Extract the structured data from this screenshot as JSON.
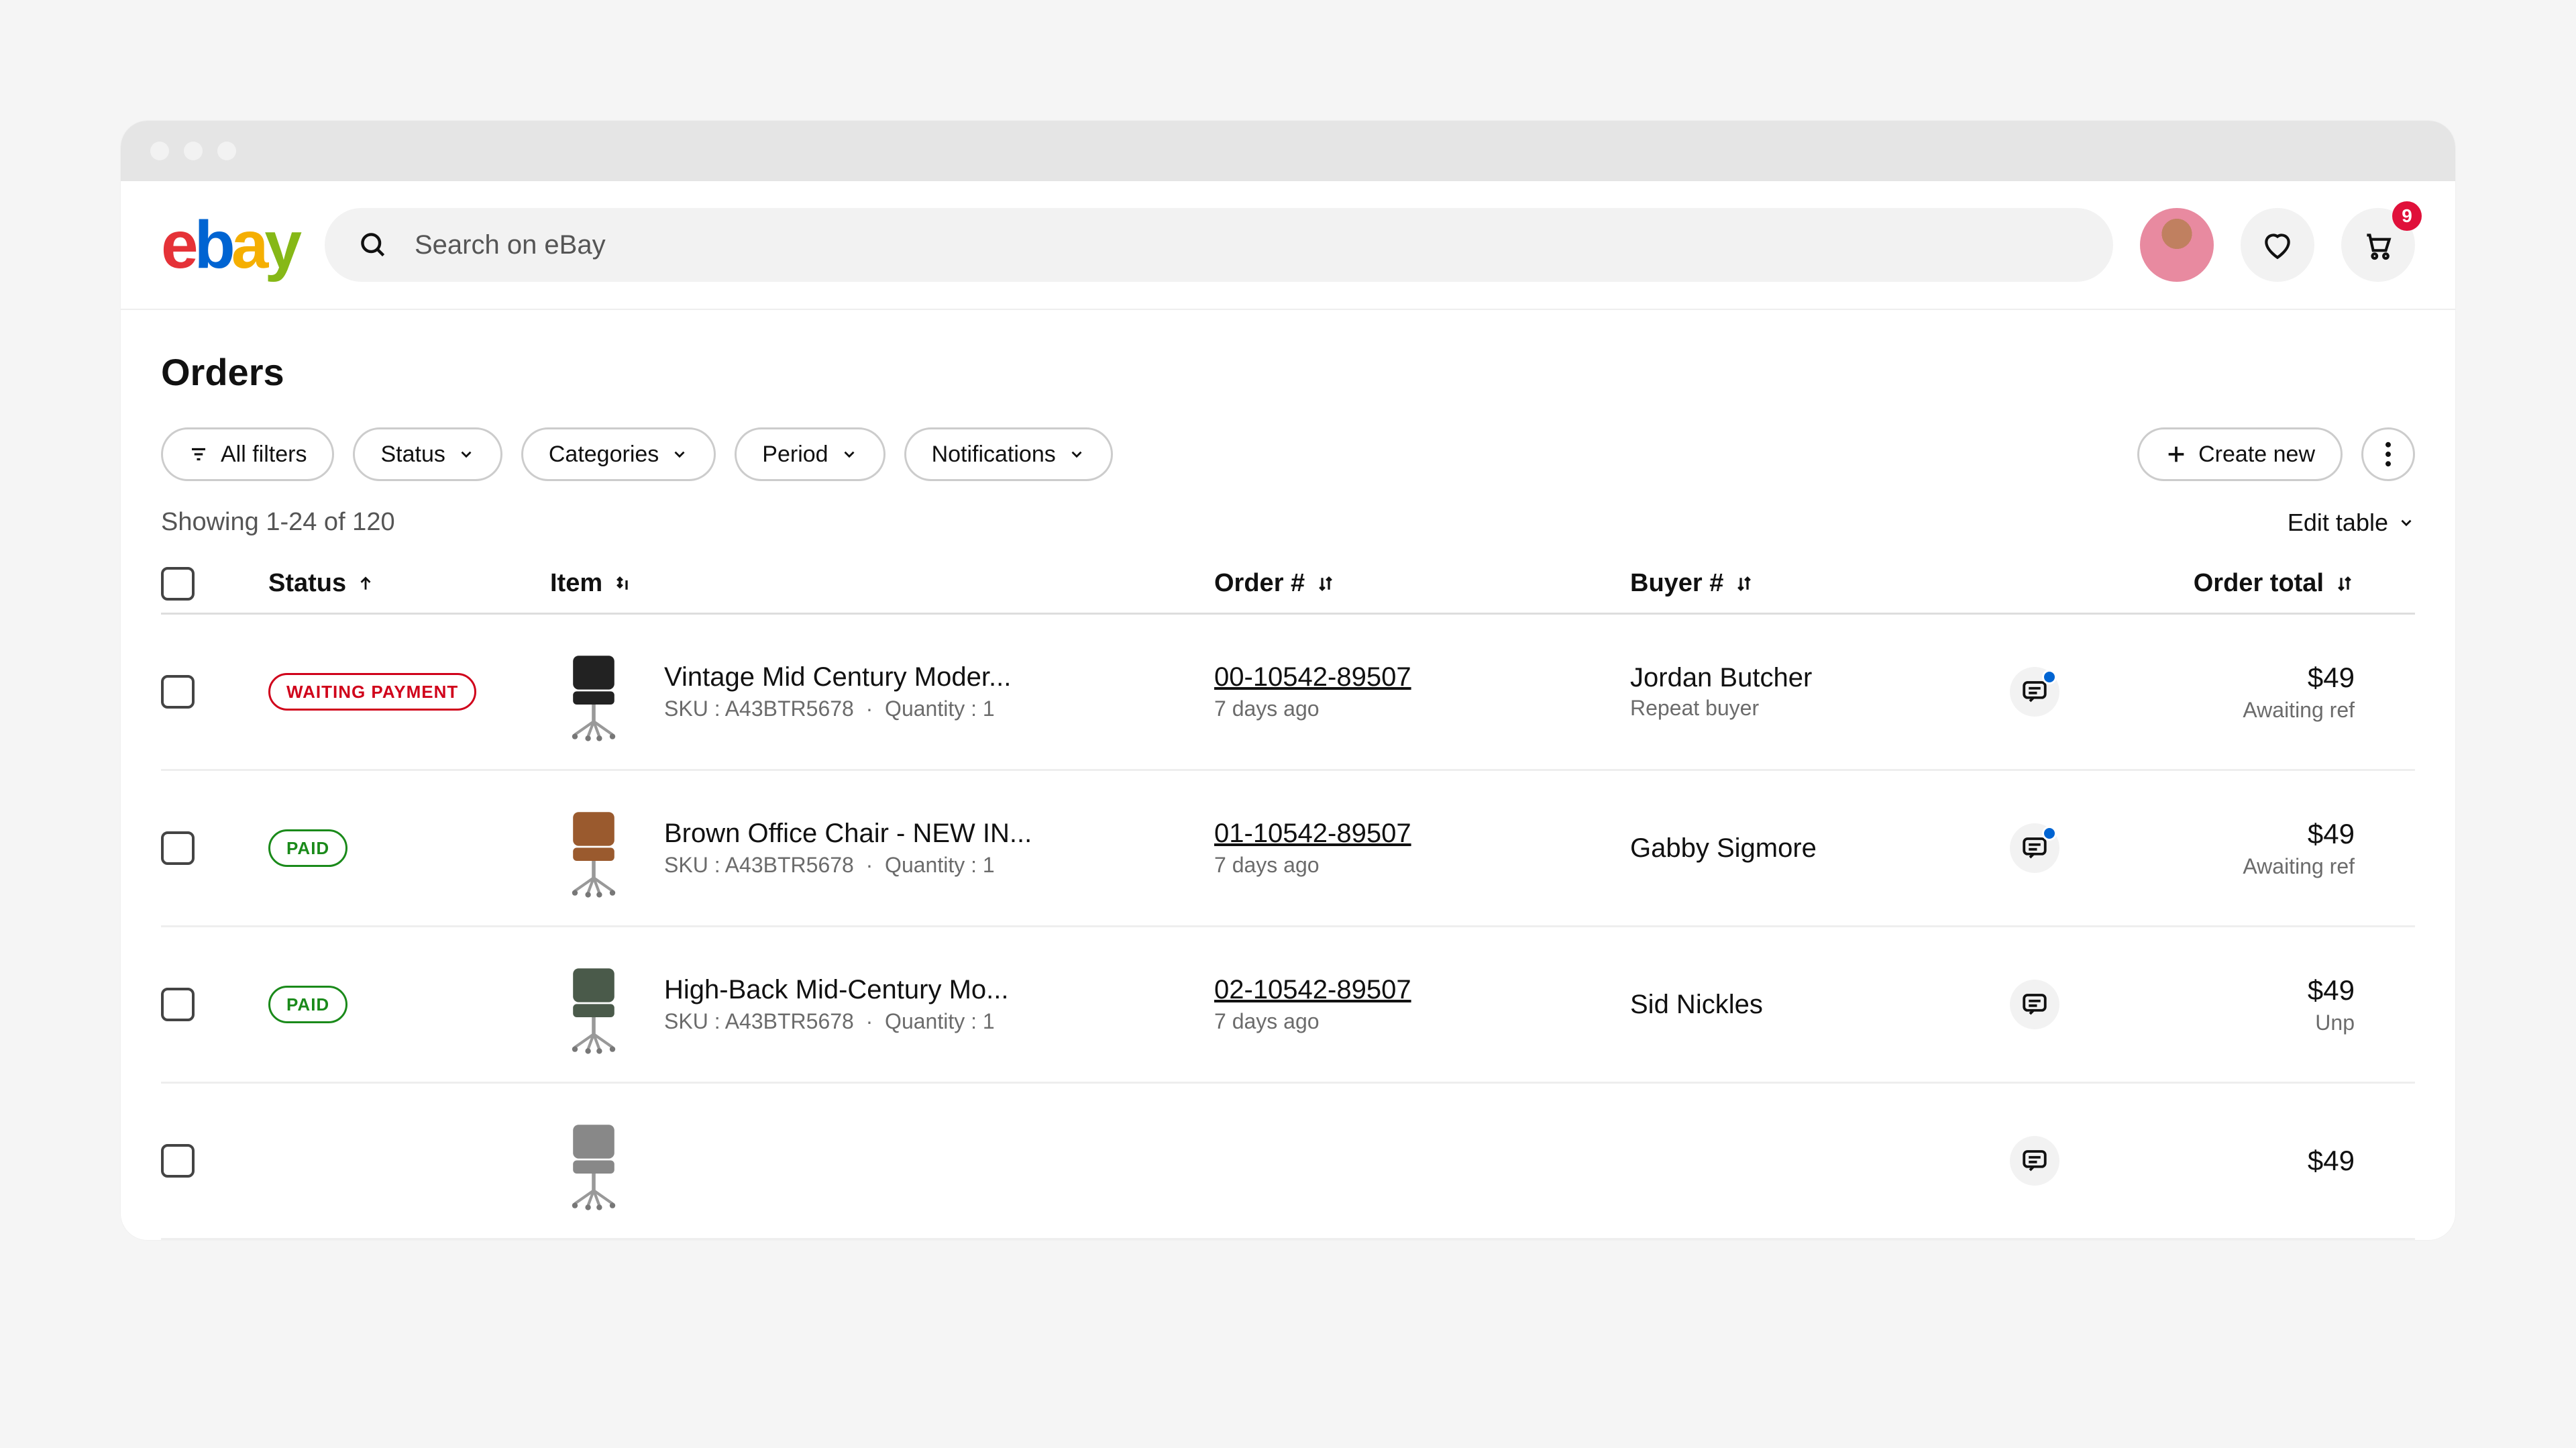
{
  "header": {
    "search_placeholder": "Search on eBay",
    "cart_badge": "9"
  },
  "page": {
    "title": "Orders",
    "showing_text": "Showing 1-24 of 120",
    "edit_table_label": "Edit table"
  },
  "filters": {
    "all_filters": "All filters",
    "status": "Status",
    "categories": "Categories",
    "period": "Period",
    "notifications": "Notifications",
    "create_new": "Create new"
  },
  "columns": {
    "status": "Status",
    "item": "Item",
    "order": "Order #",
    "buyer": "Buyer #",
    "order_total": "Order total"
  },
  "status_labels": {
    "waiting": "WAITING PAYMENT",
    "paid": "PAID"
  },
  "rows": [
    {
      "status": "waiting",
      "item_title": "Vintage Mid Century Moder...",
      "sku": "A43BTR5678",
      "quantity": "1",
      "order_number": "00-10542-89507",
      "order_age": "7 days ago",
      "buyer_name": "Jordan Butcher",
      "buyer_sub": "Repeat buyer",
      "has_msg_dot": true,
      "total": "$49",
      "total_sub": "Awaiting ref",
      "thumb_color": "#222"
    },
    {
      "status": "paid",
      "item_title": "Brown Office Chair - NEW IN...",
      "sku": "A43BTR5678",
      "quantity": "1",
      "order_number": "01-10542-89507",
      "order_age": "7 days ago",
      "buyer_name": "Gabby Sigmore",
      "buyer_sub": "",
      "has_msg_dot": true,
      "total": "$49",
      "total_sub": "Awaiting ref",
      "thumb_color": "#9a5a2e"
    },
    {
      "status": "paid",
      "item_title": "High-Back Mid-Century Mo...",
      "sku": "A43BTR5678",
      "quantity": "1",
      "order_number": "02-10542-89507",
      "order_age": "7 days ago",
      "buyer_name": "Sid Nickles",
      "buyer_sub": "",
      "has_msg_dot": false,
      "total": "$49",
      "total_sub": "Unp",
      "thumb_color": "#4a5a4a"
    },
    {
      "status": "",
      "item_title": "",
      "sku": "",
      "quantity": "",
      "order_number": "",
      "order_age": "",
      "buyer_name": "",
      "buyer_sub": "",
      "has_msg_dot": false,
      "total": "$49",
      "total_sub": "",
      "thumb_color": "#888"
    }
  ]
}
